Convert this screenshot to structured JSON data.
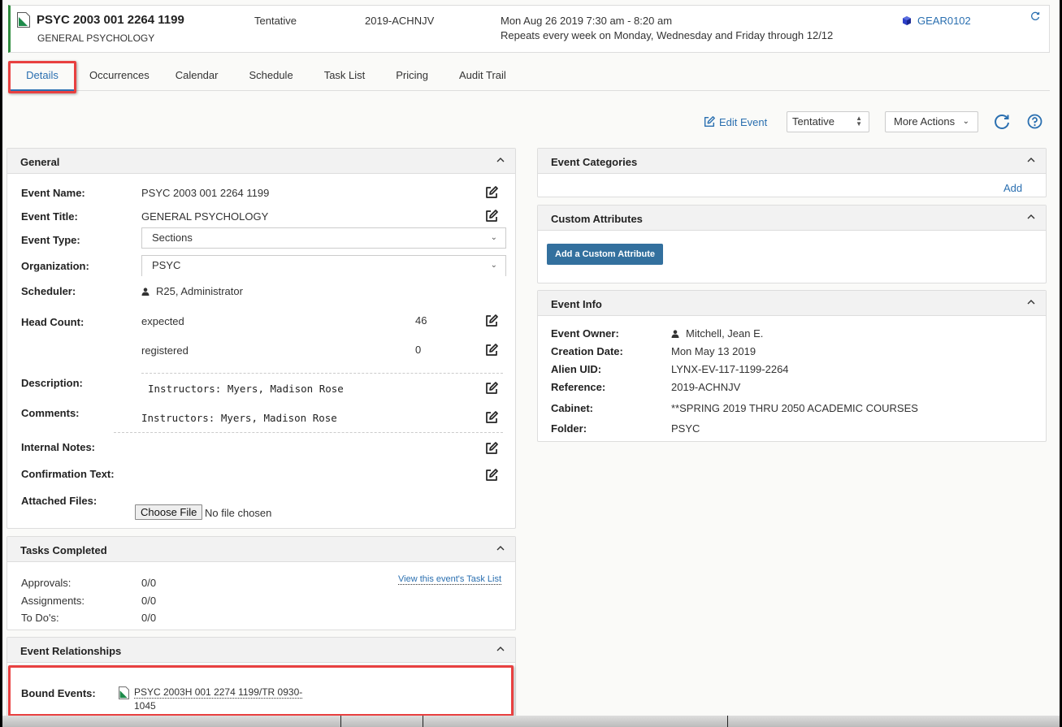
{
  "header": {
    "event_name": "PSYC 2003 001 2264 1199",
    "event_title": "GENERAL PSYCHOLOGY",
    "state": "Tentative",
    "reference": "2019-ACHNJV",
    "date_time": "Mon Aug 26 2019 7:30 am - 8:20 am",
    "repeat": "Repeats every week on Monday, Wednesday and Friday through 12/12",
    "location": "GEAR0102",
    "icons": {
      "event": "event-document-icon",
      "location": "cube-icon",
      "refresh": "refresh-icon"
    }
  },
  "tabs": [
    {
      "label": "Details",
      "active": true
    },
    {
      "label": "Occurrences",
      "active": false
    },
    {
      "label": "Calendar",
      "active": false
    },
    {
      "label": "Schedule",
      "active": false
    },
    {
      "label": "Task List",
      "active": false
    },
    {
      "label": "Pricing",
      "active": false
    },
    {
      "label": "Audit Trail",
      "active": false
    }
  ],
  "toolbar": {
    "edit_event": "Edit Event",
    "state_select": "Tentative",
    "more_actions": "More Actions",
    "icons": {
      "edit": "edit-icon",
      "refresh": "refresh-icon",
      "help": "help-icon"
    }
  },
  "general": {
    "title": "General",
    "event_name_label": "Event Name:",
    "event_name": "PSYC 2003 001 2264 1199",
    "event_title_label": "Event Title:",
    "event_title": "GENERAL PSYCHOLOGY",
    "event_type_label": "Event Type:",
    "event_type": "Sections",
    "organization_label": "Organization:",
    "organization": "PSYC",
    "scheduler_label": "Scheduler:",
    "scheduler": "R25, Administrator",
    "head_count_label": "Head Count:",
    "head_count": [
      {
        "label": "expected",
        "value": "46"
      },
      {
        "label": "registered",
        "value": "0"
      }
    ],
    "description_label": "Description:",
    "description": "Instructors: Myers, Madison Rose",
    "comments_label": "Comments:",
    "comments": "Instructors: Myers, Madison Rose",
    "internal_notes_label": "Internal Notes:",
    "confirmation_text_label": "Confirmation Text:",
    "attached_files_label": "Attached Files:",
    "choose_file": "Choose File",
    "no_file": "No file chosen"
  },
  "tasks": {
    "title": "Tasks Completed",
    "link": "View this event's Task List",
    "rows": [
      {
        "label": "Approvals:",
        "value": "0/0"
      },
      {
        "label": "Assignments:",
        "value": "0/0"
      },
      {
        "label": "To Do's:",
        "value": "0/0"
      }
    ]
  },
  "relationships": {
    "title": "Event Relationships",
    "bound_label": "Bound Events:",
    "bound_event_line1": "PSYC 2003H 001 2274 1199/TR 0930-",
    "bound_event_line2": "1045"
  },
  "categories": {
    "title": "Event Categories",
    "add": "Add"
  },
  "custom_attributes": {
    "title": "Custom Attributes",
    "add_button": "Add a Custom Attribute"
  },
  "event_info": {
    "title": "Event Info",
    "rows": [
      {
        "label": "Event Owner:",
        "value": "Mitchell, Jean E."
      },
      {
        "label": "Creation Date:",
        "value": "Mon May 13 2019"
      },
      {
        "label": "Alien UID:",
        "value": "LYNX-EV-117-1199-2264"
      },
      {
        "label": "Reference:",
        "value": "2019-ACHNJV"
      },
      {
        "label": "Cabinet:",
        "value": "**SPRING 2019 THRU 2050 ACADEMIC COURSES"
      },
      {
        "label": "Folder:",
        "value": "PSYC"
      }
    ]
  },
  "colors": {
    "accent": "#2a6fb0",
    "primary_button": "#33709e",
    "event_stripe": "#2e8b3d",
    "highlight": "#e84040"
  }
}
